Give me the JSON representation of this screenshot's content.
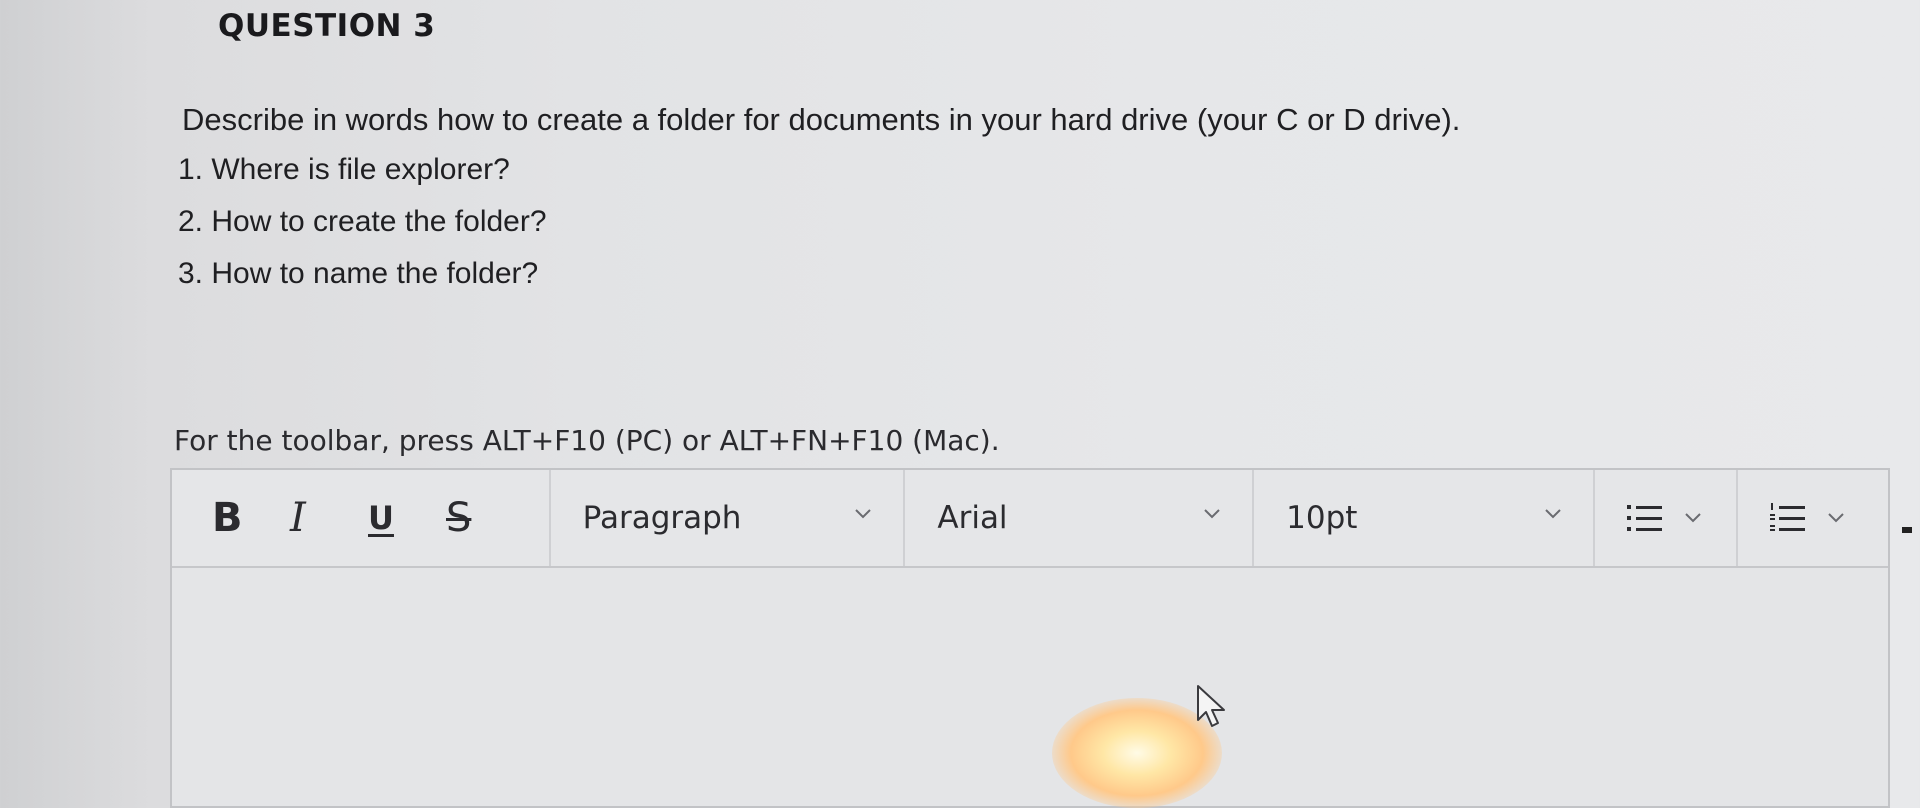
{
  "question": {
    "title": "QUESTION 3",
    "prompt": "Describe in words how to create a folder for documents in your hard drive (your C or D drive).",
    "items": [
      "1. Where is file explorer?",
      "2. How to create the folder?",
      "3. How to name the folder?"
    ]
  },
  "editor": {
    "toolbar_hint": "For the toolbar, press ALT+F10 (PC) or ALT+FN+F10 (Mac).",
    "format_buttons": {
      "bold": "B",
      "italic": "I",
      "underline": "U",
      "strikethrough": "S"
    },
    "paragraph_select": "Paragraph",
    "font_select": "Arial",
    "size_select": "10pt",
    "content": ""
  },
  "icons": {
    "chevron": "chevron-down-icon",
    "bullet_list": "bullet-list-icon",
    "numbered_list": "numbered-list-icon",
    "cursor": "mouse-pointer-icon"
  }
}
